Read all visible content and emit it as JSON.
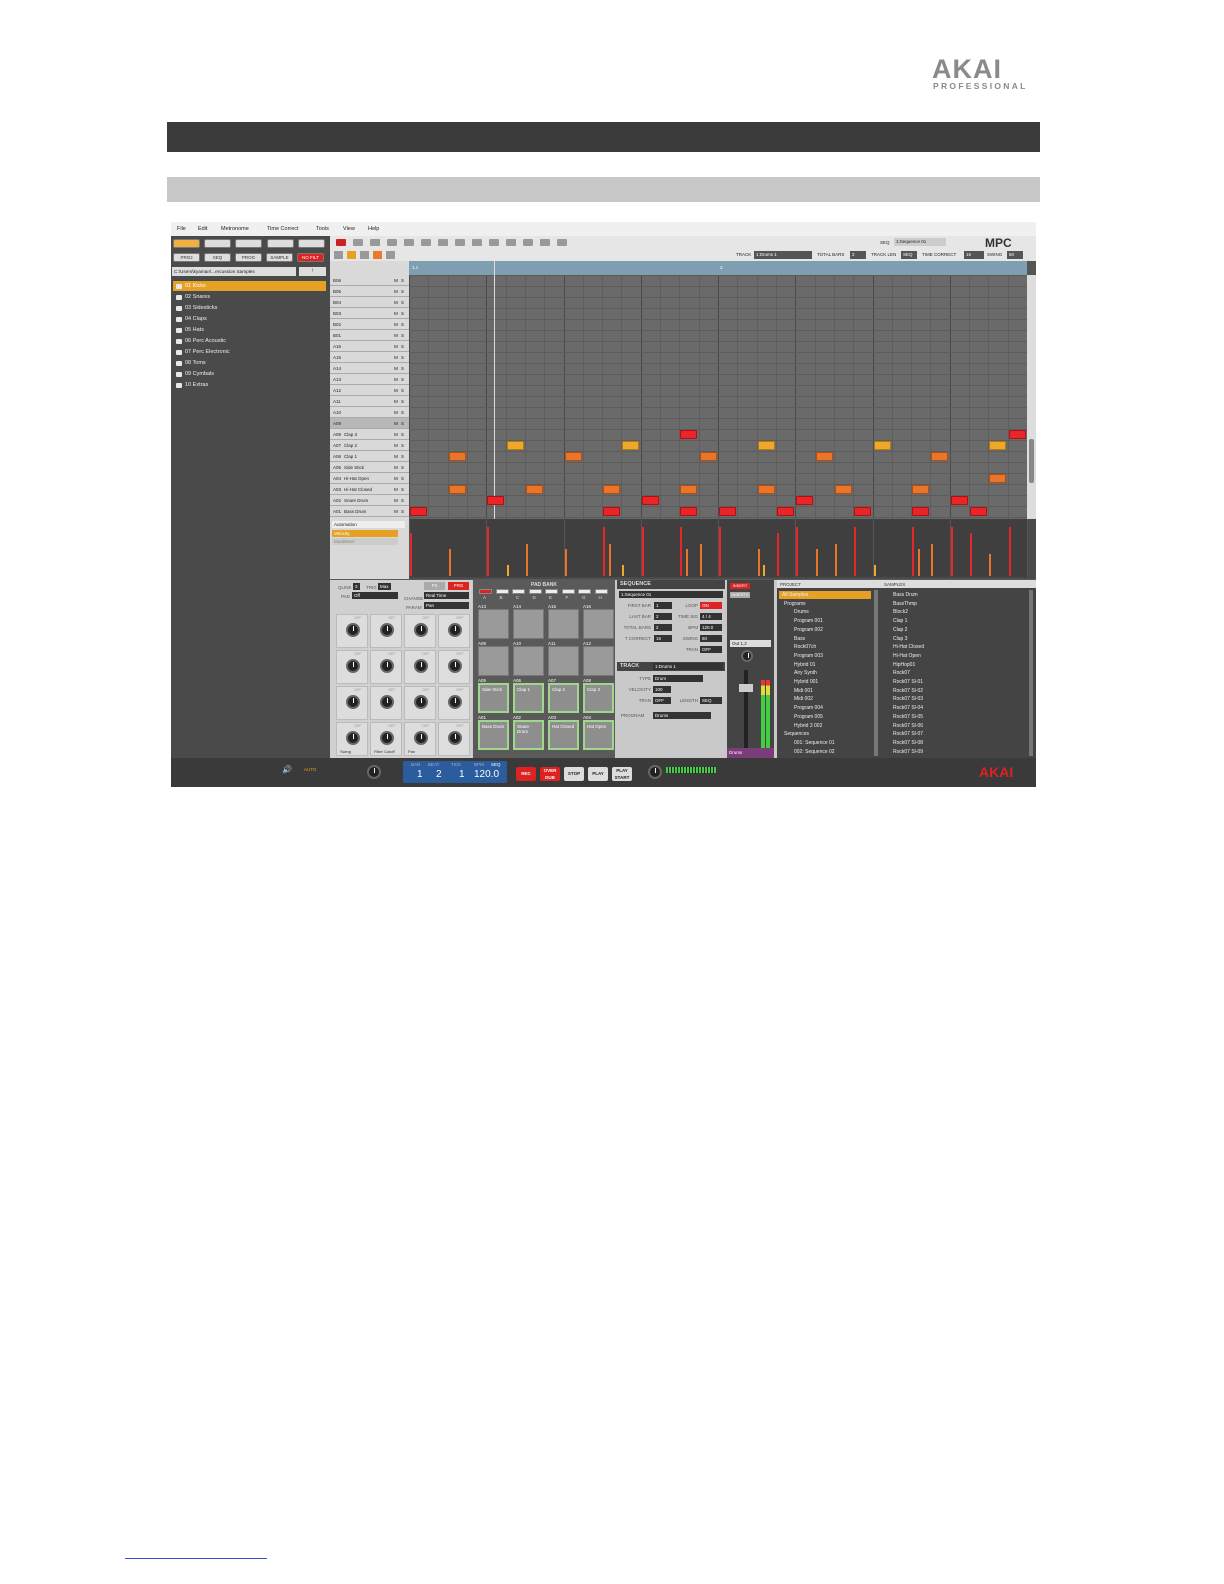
{
  "logo": {
    "word": "AKAI",
    "sub": "PROFESSIONAL"
  },
  "menu": [
    "File",
    "Edit",
    "Metronome",
    "Time Correct",
    "Tools",
    "View",
    "Help"
  ],
  "modes": [
    "PROJ",
    "SEQ",
    "PROG",
    "SAMPLE",
    "NO FILT"
  ],
  "path": "C:\\Users\\kyaman\\...ercussion Samples",
  "folders": [
    "01 Kicks",
    "02 Snares",
    "03 Sidesticks",
    "04 Claps",
    "05 Hats",
    "06 Perc Acoustic",
    "07 Perc Electronic",
    "08 Toms",
    "09 Cymbals",
    "10 Extras"
  ],
  "seq": {
    "label": "SEQ",
    "value": "1:Sequence 01"
  },
  "logo_mpc": "MPC",
  "track_bar": {
    "track_label": "TRACK",
    "track": "1:Drums 1",
    "total_bars_label": "TOTAL BARS",
    "total_bars": "2",
    "track_len_label": "TRACK LEN",
    "track_len": "SEQ",
    "tc_label": "TIME CORRECT",
    "tc": "16",
    "swing_label": "SWING",
    "swing": "50"
  },
  "ruler": [
    "1.1",
    "2"
  ],
  "lanes": [
    {
      "pad": "B06",
      "name": ""
    },
    {
      "pad": "B05",
      "name": ""
    },
    {
      "pad": "B04",
      "name": ""
    },
    {
      "pad": "B03",
      "name": ""
    },
    {
      "pad": "B02",
      "name": ""
    },
    {
      "pad": "B01",
      "name": ""
    },
    {
      "pad": "A16",
      "name": ""
    },
    {
      "pad": "A15",
      "name": ""
    },
    {
      "pad": "A14",
      "name": ""
    },
    {
      "pad": "A13",
      "name": ""
    },
    {
      "pad": "A12",
      "name": ""
    },
    {
      "pad": "A11",
      "name": ""
    },
    {
      "pad": "A10",
      "name": ""
    },
    {
      "pad": "A09",
      "name": ""
    },
    {
      "pad": "A08",
      "name": "Clap 3"
    },
    {
      "pad": "A07",
      "name": "Clap 2"
    },
    {
      "pad": "A06",
      "name": "Clap 1"
    },
    {
      "pad": "A05",
      "name": "Side Stick"
    },
    {
      "pad": "A04",
      "name": "Hi-Hat Open"
    },
    {
      "pad": "A03",
      "name": "Hi-Hat Closed"
    },
    {
      "pad": "A02",
      "name": "Snare Drum"
    },
    {
      "pad": "A01",
      "name": "Bass Drum"
    }
  ],
  "ms": {
    "m": "M",
    "s": "S"
  },
  "automation": {
    "label": "Automation",
    "items": [
      "Velocity",
      "Modwheel"
    ]
  },
  "qlink": {
    "qlink_label": "QLINK",
    "qlink": "3",
    "trig_label": "TRIG",
    "trig": "Max",
    "pad_label": "PAD",
    "pad": "Off",
    "change_label": "CHANGE",
    "change": "Real Time",
    "param_label": "PARAM",
    "param": "Pan",
    "fx": "FX",
    "prg": "PRG"
  },
  "knobs": [
    "Swing",
    "Filter Cutoff",
    "Pan"
  ],
  "knob_off": "OFF",
  "padbank": {
    "title": "PAD BANK",
    "banks": [
      "A",
      "B",
      "C",
      "D",
      "E",
      "F",
      "G",
      "H"
    ],
    "rows": [
      [
        {
          "id": "A13",
          "n": ""
        },
        {
          "id": "A14",
          "n": ""
        },
        {
          "id": "A15",
          "n": ""
        },
        {
          "id": "A16",
          "n": ""
        }
      ],
      [
        {
          "id": "A09",
          "n": ""
        },
        {
          "id": "A10",
          "n": ""
        },
        {
          "id": "A11",
          "n": ""
        },
        {
          "id": "A12",
          "n": ""
        }
      ],
      [
        {
          "id": "A05",
          "n": "Side Stick"
        },
        {
          "id": "A06",
          "n": "Clap 1"
        },
        {
          "id": "A07",
          "n": "Clap 2"
        },
        {
          "id": "A08",
          "n": "Clap 3"
        }
      ],
      [
        {
          "id": "A01",
          "n": "Bass Drum"
        },
        {
          "id": "A02",
          "n": "Snare Drum"
        },
        {
          "id": "A03",
          "n": "Hat Closed"
        },
        {
          "id": "A04",
          "n": "Hat Open"
        }
      ]
    ]
  },
  "sequence": {
    "title": "SEQUENCE",
    "name": "1:Sequence 01",
    "first_bar_l": "FIRST BAR",
    "first_bar": "1",
    "loop_l": "LOOP",
    "loop": "ON",
    "last_bar_l": "LAST BAR",
    "last_bar": "2",
    "time_sig_l": "TIME SIG",
    "time_sig": "4 / 4",
    "total_bars_l": "TOTAL BARS",
    "total_bars": "2",
    "bpm_l": "BPM",
    "bpm": "120.0",
    "tc_l": "T CORRECT",
    "tc": "16",
    "swing_l": "SWING",
    "swing": "50",
    "tran_l": "TRAN",
    "tran": "OFF"
  },
  "track": {
    "title": "TRACK",
    "name": "1:Drums 1",
    "type_l": "TYPE",
    "type": "Drum",
    "vel_l": "VELOCITY",
    "vel": "100",
    "tran_l": "TRAN",
    "tran": "OFF",
    "length_l": "LENGTH",
    "length": "SEQ",
    "program_l": "PROGRAM",
    "program": "Drums"
  },
  "mixer": {
    "insert": "INSERT",
    "insert2": "INSERTS",
    "out": "Out 1,2",
    "ch": "Drums"
  },
  "project": {
    "title": "PROJECT",
    "items": [
      "All Samples",
      "Programs",
      "Drums",
      "Program 001",
      "Program 002",
      "Bass",
      "Rock07ch",
      "Program 003",
      "Hybrid 01",
      "Airy Synth",
      "Hybrid 001",
      "Midi 001",
      "Midi 002",
      "Program 004",
      "Program 005",
      "Hybrid 3 002",
      "Sequences",
      "001: Sequence 01",
      "002: Sequence 02"
    ]
  },
  "samples": {
    "title": "SAMPLES",
    "items": [
      "Bass Drum",
      "BassThmp",
      "Block2",
      "Clap 1",
      "Clap 2",
      "Clap 3",
      "Hi-Hat Closed",
      "Hi-Hat Open",
      "HipHop01",
      "Rock07",
      "Rock07 Sl-01",
      "Rock07 Sl-02",
      "Rock07 Sl-03",
      "Rock07 Sl-04",
      "Rock07 Sl-05",
      "Rock07 Sl-06",
      "Rock07 Sl-07",
      "Rock07 Sl-08",
      "Rock07 Sl-09"
    ]
  },
  "transport": {
    "auto": "AUTO",
    "bar_l": "BAR",
    "beat_l": "BEAT",
    "tick_l": "TICK",
    "bpm_l": "BPM",
    "seq_l": "SEQ",
    "bar": "1",
    "beat": "2",
    "tick": "1",
    "bpm": "120.0",
    "rec": "REC",
    "overdub": "OVER DUB",
    "stop": "STOP",
    "play": "PLAY",
    "playstart": "PLAY START",
    "brand": "AKAI"
  },
  "colors": {
    "note_red": "#e8262a",
    "note_orange": "#e8752a",
    "note_yellow": "#eea82c",
    "selected_folder": "#e6a023",
    "ruler": "#7e9fb2"
  },
  "notes": [
    {
      "lane": 21,
      "step": 0,
      "c": "red"
    },
    {
      "lane": 20,
      "step": 4,
      "c": "red"
    },
    {
      "lane": 19,
      "step": 2,
      "c": "or"
    },
    {
      "lane": 16,
      "step": 2,
      "c": "or"
    },
    {
      "lane": 15,
      "step": 5,
      "c": "yl"
    },
    {
      "lane": 19,
      "step": 6,
      "c": "or"
    },
    {
      "lane": 16,
      "step": 8,
      "c": "or"
    },
    {
      "lane": 21,
      "step": 10,
      "c": "red"
    },
    {
      "lane": 19,
      "step": 10,
      "c": "or"
    },
    {
      "lane": 15,
      "step": 11,
      "c": "yl"
    },
    {
      "lane": 20,
      "step": 12,
      "c": "red"
    },
    {
      "lane": 14,
      "step": 14,
      "c": "red"
    },
    {
      "lane": 21,
      "step": 14,
      "c": "red"
    },
    {
      "lane": 19,
      "step": 14,
      "c": "or"
    },
    {
      "lane": 16,
      "step": 15,
      "c": "or"
    },
    {
      "lane": 21,
      "step": 16,
      "c": "red"
    },
    {
      "lane": 15,
      "step": 18,
      "c": "yl"
    },
    {
      "lane": 19,
      "step": 18,
      "c": "or"
    },
    {
      "lane": 21,
      "step": 19,
      "c": "red"
    },
    {
      "lane": 20,
      "step": 20,
      "c": "red"
    },
    {
      "lane": 16,
      "step": 21,
      "c": "or"
    },
    {
      "lane": 19,
      "step": 22,
      "c": "or"
    },
    {
      "lane": 21,
      "step": 23,
      "c": "red"
    },
    {
      "lane": 15,
      "step": 24,
      "c": "yl"
    },
    {
      "lane": 19,
      "step": 26,
      "c": "or"
    },
    {
      "lane": 21,
      "step": 26,
      "c": "red"
    },
    {
      "lane": 16,
      "step": 27,
      "c": "or"
    },
    {
      "lane": 20,
      "step": 28,
      "c": "red"
    },
    {
      "lane": 21,
      "step": 29,
      "c": "red"
    },
    {
      "lane": 15,
      "step": 30,
      "c": "yl"
    },
    {
      "lane": 18,
      "step": 30,
      "c": "or"
    },
    {
      "lane": 14,
      "step": 31,
      "c": "red"
    }
  ],
  "velocity_bars": [
    {
      "step": 0,
      "h": 0.8,
      "c": "red"
    },
    {
      "step": 2,
      "h": 0.5,
      "c": "or"
    },
    {
      "step": 4,
      "h": 0.9,
      "c": "red"
    },
    {
      "step": 5,
      "h": 0.2,
      "c": "yl"
    },
    {
      "step": 6,
      "h": 0.6,
      "c": "or"
    },
    {
      "step": 8,
      "h": 0.5,
      "c": "or"
    },
    {
      "step": 10,
      "h": 0.9,
      "c": "red"
    },
    {
      "step": 10.3,
      "h": 0.6,
      "c": "or"
    },
    {
      "step": 11,
      "h": 0.2,
      "c": "yl"
    },
    {
      "step": 12,
      "h": 0.9,
      "c": "red"
    },
    {
      "step": 14,
      "h": 0.9,
      "c": "red"
    },
    {
      "step": 14.3,
      "h": 0.5,
      "c": "or"
    },
    {
      "step": 15,
      "h": 0.6,
      "c": "or"
    },
    {
      "step": 16,
      "h": 0.9,
      "c": "red"
    },
    {
      "step": 18,
      "h": 0.5,
      "c": "or"
    },
    {
      "step": 18.3,
      "h": 0.2,
      "c": "yl"
    },
    {
      "step": 19,
      "h": 0.8,
      "c": "red"
    },
    {
      "step": 20,
      "h": 0.9,
      "c": "red"
    },
    {
      "step": 21,
      "h": 0.5,
      "c": "or"
    },
    {
      "step": 22,
      "h": 0.6,
      "c": "or"
    },
    {
      "step": 23,
      "h": 0.9,
      "c": "red"
    },
    {
      "step": 24,
      "h": 0.2,
      "c": "yl"
    },
    {
      "step": 26,
      "h": 0.9,
      "c": "red"
    },
    {
      "step": 26.3,
      "h": 0.5,
      "c": "or"
    },
    {
      "step": 27,
      "h": 0.6,
      "c": "or"
    },
    {
      "step": 28,
      "h": 0.9,
      "c": "red"
    },
    {
      "step": 29,
      "h": 0.8,
      "c": "red"
    },
    {
      "step": 30,
      "h": 0.4,
      "c": "or"
    },
    {
      "step": 31,
      "h": 0.9,
      "c": "red"
    }
  ]
}
